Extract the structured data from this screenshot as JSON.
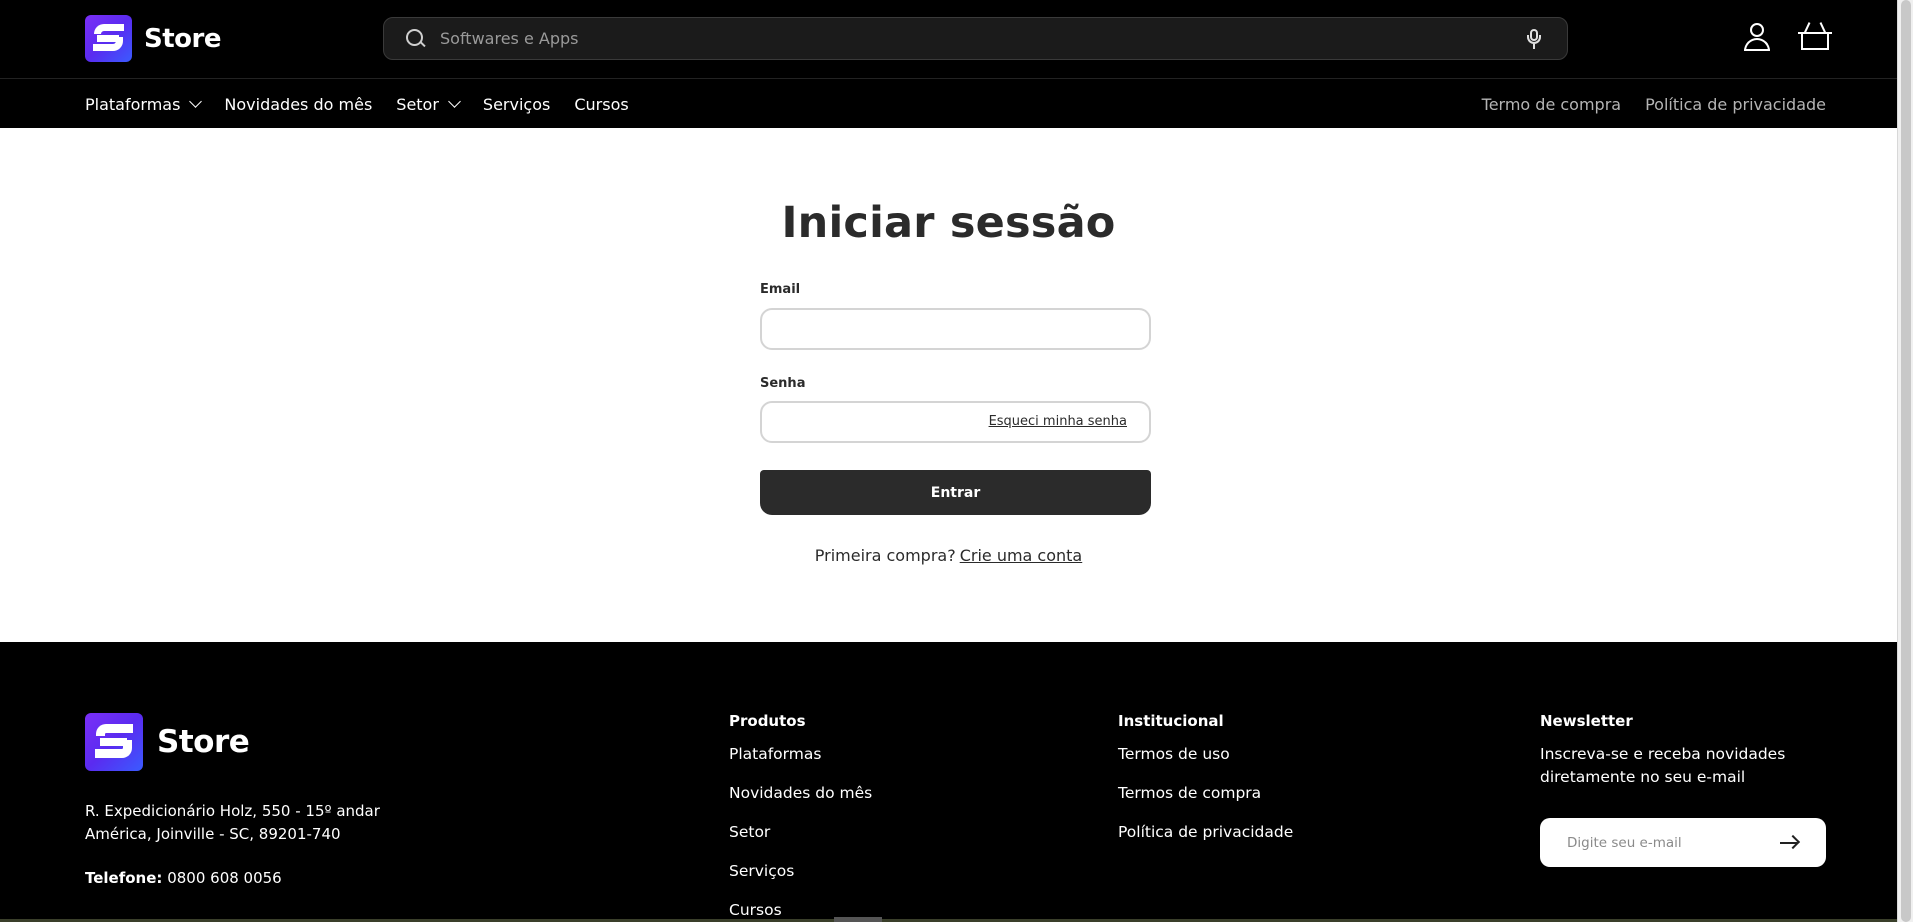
{
  "brand": {
    "name": "Store"
  },
  "search": {
    "placeholder": "Softwares e Apps"
  },
  "nav": {
    "items": [
      {
        "label": "Plataformas",
        "has_dropdown": true
      },
      {
        "label": "Novidades do mês",
        "has_dropdown": false
      },
      {
        "label": "Setor",
        "has_dropdown": true
      },
      {
        "label": "Serviços",
        "has_dropdown": false
      },
      {
        "label": "Cursos",
        "has_dropdown": false
      }
    ],
    "right_links": [
      "Termo de compra",
      "Política de privacidade"
    ]
  },
  "login": {
    "title": "Iniciar sessão",
    "email_label": "Email",
    "password_label": "Senha",
    "forgot_label": "Esqueci minha senha",
    "submit_label": "Entrar",
    "signup_prompt": "Primeira compra?",
    "signup_link": "Crie uma conta"
  },
  "footer": {
    "address_line1": "R. Expedicionário Holz, 550 - 15º andar",
    "address_line2": "América, Joinville - SC, 89201-740",
    "phone_label": "Telefone:",
    "phone_value": "0800 608 0056",
    "produtos": {
      "title": "Produtos",
      "links": [
        "Plataformas",
        "Novidades do mês",
        "Setor",
        "Serviços",
        "Cursos"
      ]
    },
    "institucional": {
      "title": "Institucional",
      "links": [
        "Termos de uso",
        "Termos de compra",
        "Política de privacidade"
      ]
    },
    "newsletter": {
      "title": "Newsletter",
      "text": "Inscreva-se e receba novidades diretamente no seu e-mail",
      "placeholder": "Digite seu e-mail"
    }
  },
  "colors": {
    "header_bg": "#000000",
    "button_bg": "#2b2b2b",
    "logo_gradient_start": "#7b2ff7",
    "logo_gradient_end": "#3a5bff"
  },
  "icons": [
    "search-icon",
    "mic-icon",
    "account-icon",
    "cart-icon",
    "chevron-down-icon",
    "arrow-right-icon"
  ]
}
